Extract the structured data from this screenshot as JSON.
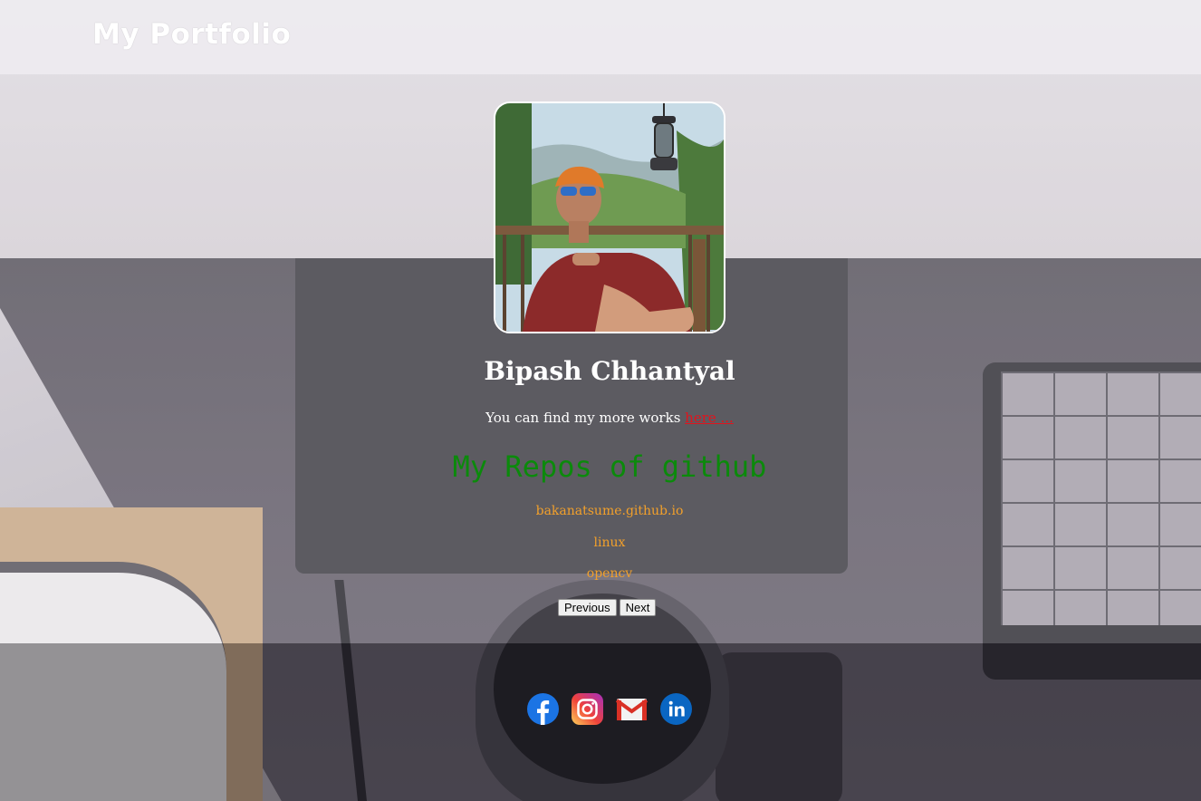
{
  "header": {
    "title": "My Portfolio"
  },
  "profile": {
    "name": "Bipash Chhantyal",
    "intro_text": "You can find my more works ",
    "intro_link": "here ...",
    "photo_icon": "profile-photo"
  },
  "repos": {
    "heading": "My Repos of github",
    "items": [
      "bakanatsume.github.io",
      "linux",
      "opencv"
    ],
    "previous_label": "Previous",
    "next_label": "Next"
  },
  "social": {
    "icons": [
      "facebook-icon",
      "instagram-icon",
      "gmail-icon",
      "linkedin-icon"
    ]
  },
  "colors": {
    "heading_green": "#0b8a0b",
    "repo_orange": "#f2a02b",
    "link_red": "#e0141d"
  }
}
